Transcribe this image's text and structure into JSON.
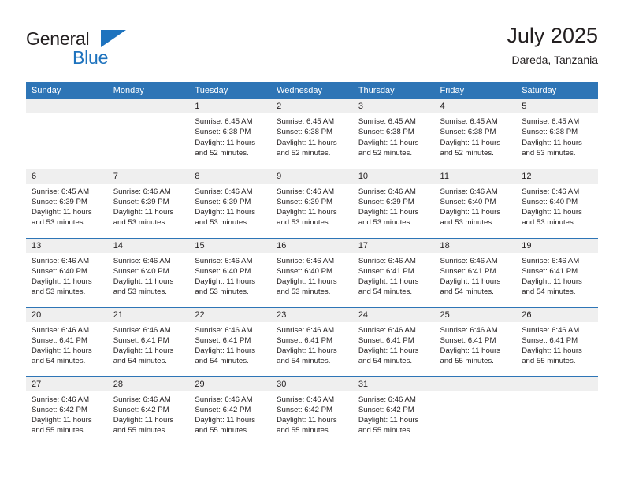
{
  "brand": {
    "name_top": "General",
    "name_bottom": "Blue",
    "triangle_color": "#1e73be",
    "text_color": "#231f20"
  },
  "header": {
    "title": "July 2025",
    "subtitle": "Dareda, Tanzania"
  },
  "theme": {
    "header_bg": "#2e75b6",
    "header_text": "#ffffff",
    "daynum_band_bg": "#efefef",
    "row_divider": "#2e75b6",
    "body_text": "#231f20"
  },
  "weekday_headers": [
    "Sunday",
    "Monday",
    "Tuesday",
    "Wednesday",
    "Thursday",
    "Friday",
    "Saturday"
  ],
  "weeks": [
    [
      {
        "day": "",
        "blank": true,
        "sunrise": "",
        "sunset": "",
        "daylight": ""
      },
      {
        "day": "",
        "blank": true,
        "sunrise": "",
        "sunset": "",
        "daylight": ""
      },
      {
        "day": "1",
        "sunrise": "Sunrise: 6:45 AM",
        "sunset": "Sunset: 6:38 PM",
        "daylight": "Daylight: 11 hours and 52 minutes."
      },
      {
        "day": "2",
        "sunrise": "Sunrise: 6:45 AM",
        "sunset": "Sunset: 6:38 PM",
        "daylight": "Daylight: 11 hours and 52 minutes."
      },
      {
        "day": "3",
        "sunrise": "Sunrise: 6:45 AM",
        "sunset": "Sunset: 6:38 PM",
        "daylight": "Daylight: 11 hours and 52 minutes."
      },
      {
        "day": "4",
        "sunrise": "Sunrise: 6:45 AM",
        "sunset": "Sunset: 6:38 PM",
        "daylight": "Daylight: 11 hours and 52 minutes."
      },
      {
        "day": "5",
        "sunrise": "Sunrise: 6:45 AM",
        "sunset": "Sunset: 6:38 PM",
        "daylight": "Daylight: 11 hours and 53 minutes."
      }
    ],
    [
      {
        "day": "6",
        "sunrise": "Sunrise: 6:45 AM",
        "sunset": "Sunset: 6:39 PM",
        "daylight": "Daylight: 11 hours and 53 minutes."
      },
      {
        "day": "7",
        "sunrise": "Sunrise: 6:46 AM",
        "sunset": "Sunset: 6:39 PM",
        "daylight": "Daylight: 11 hours and 53 minutes."
      },
      {
        "day": "8",
        "sunrise": "Sunrise: 6:46 AM",
        "sunset": "Sunset: 6:39 PM",
        "daylight": "Daylight: 11 hours and 53 minutes."
      },
      {
        "day": "9",
        "sunrise": "Sunrise: 6:46 AM",
        "sunset": "Sunset: 6:39 PM",
        "daylight": "Daylight: 11 hours and 53 minutes."
      },
      {
        "day": "10",
        "sunrise": "Sunrise: 6:46 AM",
        "sunset": "Sunset: 6:39 PM",
        "daylight": "Daylight: 11 hours and 53 minutes."
      },
      {
        "day": "11",
        "sunrise": "Sunrise: 6:46 AM",
        "sunset": "Sunset: 6:40 PM",
        "daylight": "Daylight: 11 hours and 53 minutes."
      },
      {
        "day": "12",
        "sunrise": "Sunrise: 6:46 AM",
        "sunset": "Sunset: 6:40 PM",
        "daylight": "Daylight: 11 hours and 53 minutes."
      }
    ],
    [
      {
        "day": "13",
        "sunrise": "Sunrise: 6:46 AM",
        "sunset": "Sunset: 6:40 PM",
        "daylight": "Daylight: 11 hours and 53 minutes."
      },
      {
        "day": "14",
        "sunrise": "Sunrise: 6:46 AM",
        "sunset": "Sunset: 6:40 PM",
        "daylight": "Daylight: 11 hours and 53 minutes."
      },
      {
        "day": "15",
        "sunrise": "Sunrise: 6:46 AM",
        "sunset": "Sunset: 6:40 PM",
        "daylight": "Daylight: 11 hours and 53 minutes."
      },
      {
        "day": "16",
        "sunrise": "Sunrise: 6:46 AM",
        "sunset": "Sunset: 6:40 PM",
        "daylight": "Daylight: 11 hours and 53 minutes."
      },
      {
        "day": "17",
        "sunrise": "Sunrise: 6:46 AM",
        "sunset": "Sunset: 6:41 PM",
        "daylight": "Daylight: 11 hours and 54 minutes."
      },
      {
        "day": "18",
        "sunrise": "Sunrise: 6:46 AM",
        "sunset": "Sunset: 6:41 PM",
        "daylight": "Daylight: 11 hours and 54 minutes."
      },
      {
        "day": "19",
        "sunrise": "Sunrise: 6:46 AM",
        "sunset": "Sunset: 6:41 PM",
        "daylight": "Daylight: 11 hours and 54 minutes."
      }
    ],
    [
      {
        "day": "20",
        "sunrise": "Sunrise: 6:46 AM",
        "sunset": "Sunset: 6:41 PM",
        "daylight": "Daylight: 11 hours and 54 minutes."
      },
      {
        "day": "21",
        "sunrise": "Sunrise: 6:46 AM",
        "sunset": "Sunset: 6:41 PM",
        "daylight": "Daylight: 11 hours and 54 minutes."
      },
      {
        "day": "22",
        "sunrise": "Sunrise: 6:46 AM",
        "sunset": "Sunset: 6:41 PM",
        "daylight": "Daylight: 11 hours and 54 minutes."
      },
      {
        "day": "23",
        "sunrise": "Sunrise: 6:46 AM",
        "sunset": "Sunset: 6:41 PM",
        "daylight": "Daylight: 11 hours and 54 minutes."
      },
      {
        "day": "24",
        "sunrise": "Sunrise: 6:46 AM",
        "sunset": "Sunset: 6:41 PM",
        "daylight": "Daylight: 11 hours and 54 minutes."
      },
      {
        "day": "25",
        "sunrise": "Sunrise: 6:46 AM",
        "sunset": "Sunset: 6:41 PM",
        "daylight": "Daylight: 11 hours and 55 minutes."
      },
      {
        "day": "26",
        "sunrise": "Sunrise: 6:46 AM",
        "sunset": "Sunset: 6:41 PM",
        "daylight": "Daylight: 11 hours and 55 minutes."
      }
    ],
    [
      {
        "day": "27",
        "sunrise": "Sunrise: 6:46 AM",
        "sunset": "Sunset: 6:42 PM",
        "daylight": "Daylight: 11 hours and 55 minutes."
      },
      {
        "day": "28",
        "sunrise": "Sunrise: 6:46 AM",
        "sunset": "Sunset: 6:42 PM",
        "daylight": "Daylight: 11 hours and 55 minutes."
      },
      {
        "day": "29",
        "sunrise": "Sunrise: 6:46 AM",
        "sunset": "Sunset: 6:42 PM",
        "daylight": "Daylight: 11 hours and 55 minutes."
      },
      {
        "day": "30",
        "sunrise": "Sunrise: 6:46 AM",
        "sunset": "Sunset: 6:42 PM",
        "daylight": "Daylight: 11 hours and 55 minutes."
      },
      {
        "day": "31",
        "sunrise": "Sunrise: 6:46 AM",
        "sunset": "Sunset: 6:42 PM",
        "daylight": "Daylight: 11 hours and 55 minutes."
      },
      {
        "day": "",
        "blank": true,
        "sunrise": "",
        "sunset": "",
        "daylight": ""
      },
      {
        "day": "",
        "blank": true,
        "sunrise": "",
        "sunset": "",
        "daylight": ""
      }
    ]
  ]
}
